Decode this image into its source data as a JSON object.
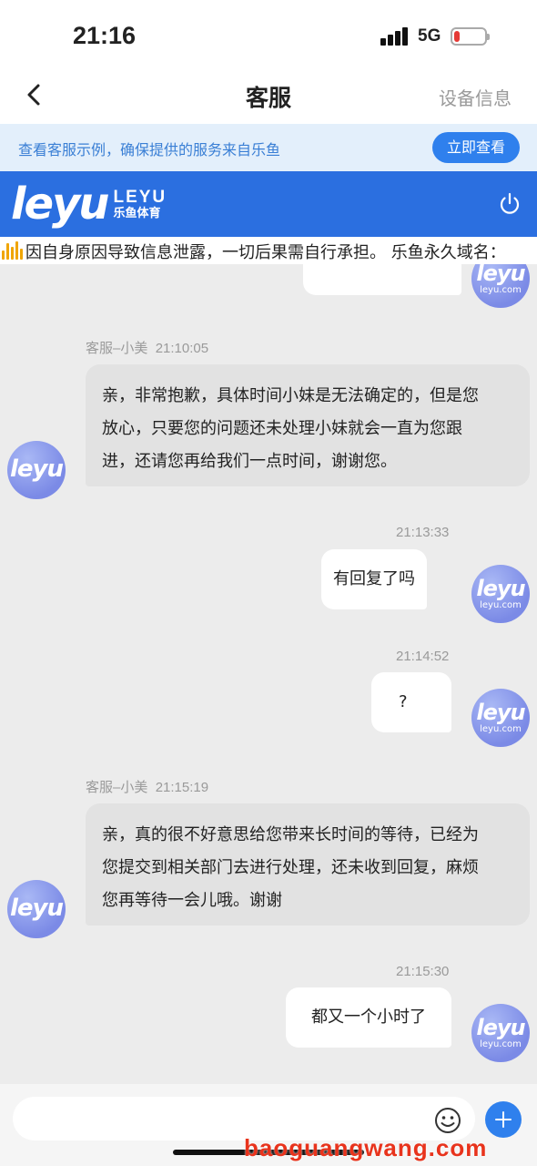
{
  "status_bar": {
    "time": "21:16",
    "network": "5G",
    "battery_level": 0.2,
    "battery_color": "#e53935"
  },
  "header": {
    "back_icon": "chevron-left-icon",
    "title": "客服",
    "device_info_label": "设备信息"
  },
  "notice": {
    "text": "查看客服示例，确保提供的服务来自乐鱼",
    "button_label": "立即查看",
    "accent_color": "#2f80ed"
  },
  "brand": {
    "logo_mark": "leyu",
    "logo_en": "LEYU",
    "logo_cn": "乐鱼体育",
    "power_icon": "power-icon",
    "bar_color": "#2b6fe0"
  },
  "marquee": {
    "icon": "speaker-icon",
    "text": "因自身原因导致信息泄露，一切后果需自行承担。 乐鱼永久域名："
  },
  "avatars": {
    "agent_logo": "leyu",
    "user_logo": "leyu",
    "user_sub": "leyu.com"
  },
  "messages": [
    {
      "from": "agent",
      "sender": "客服–小美",
      "time": "21:10:05",
      "lines": [
        "亲，非常抱歉，具体时间小妹是无法确定的，但是您",
        "放心，只要您的问题还未处理小妹就会一直为您跟",
        "进，还请您再给我们一点时间，谢谢您。"
      ]
    },
    {
      "from": "user",
      "time": "21:13:33",
      "text": "有回复了吗"
    },
    {
      "from": "user",
      "time": "21:14:52",
      "text": "?"
    },
    {
      "from": "agent",
      "sender": "客服–小美",
      "time": "21:15:19",
      "lines": [
        "亲，真的很不好意思给您带来长时间的等待，已经为",
        "您提交到相关部门去进行处理，还未收到回复，麻烦",
        "您再等待一会儿哦。谢谢"
      ]
    },
    {
      "from": "user",
      "time": "21:15:30",
      "text": "都又一个小时了"
    }
  ],
  "input_bar": {
    "placeholder": "",
    "emoji_icon": "emoji-icon",
    "add_icon": "plus-icon"
  },
  "watermark": "baoguangwang.com"
}
